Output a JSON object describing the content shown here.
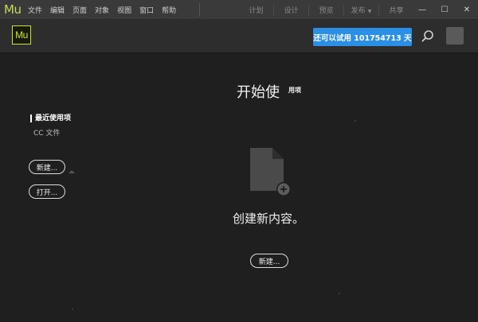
{
  "titlebar": {
    "app_glyph": "Mu",
    "menu": [
      "文件",
      "编辑",
      "页面",
      "对象",
      "视图",
      "窗口",
      "帮助"
    ],
    "modes": [
      "计划",
      "设计",
      "预览",
      "发布",
      "共享"
    ],
    "window_buttons": {
      "minimize": "—",
      "maximize": "☐",
      "close": "✕"
    }
  },
  "appbar": {
    "logo": "Mu",
    "trial_button": "还可以试用 101754713 天"
  },
  "start": {
    "title": "开始使",
    "title_tail": "用项",
    "sidebar": {
      "recent": "最近使用项",
      "cc_files": "CC 文件",
      "new_button": "新建...",
      "open_button": "打开..."
    },
    "create_text": "创建新内容。",
    "new_button": "新建..."
  },
  "colors": {
    "accent_blue": "#2b8fe6",
    "logo_lime": "#c8e62a",
    "background": "#1f1f1f"
  },
  "icons": [
    "search-icon",
    "document-add-icon",
    "account-icon"
  ]
}
